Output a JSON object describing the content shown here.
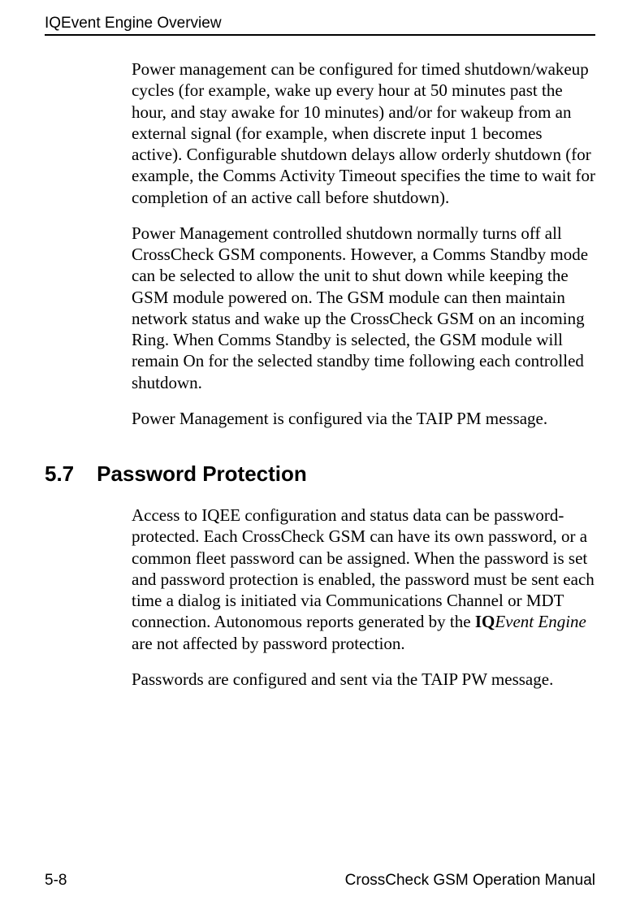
{
  "header": {
    "title": "IQEvent Engine Overview"
  },
  "content": {
    "para1": "Power management can be configured for timed shutdown/wakeup cycles (for example, wake up every hour at 50 minutes past the hour, and stay awake for 10 minutes) and/or for wakeup from an external signal (for example, when discrete input 1 becomes active). Configurable shutdown delays allow orderly shutdown (for example, the Comms Activity Timeout specifies the time to wait for completion of an active call before shutdown).",
    "para2": "Power Management controlled shutdown normally turns off all CrossCheck GSM components. However, a Comms Standby mode can be selected to allow the unit to shut down while keeping the GSM module powered on. The GSM module can then maintain network status and wake up the CrossCheck GSM on an incoming Ring. When Comms Standby is selected, the GSM module will remain On for the selected standby time following each controlled shutdown.",
    "para3": "Power Management is configured via the TAIP PM message."
  },
  "section": {
    "number": "5.7",
    "title": "Password Protection",
    "para1_part1": "Access to IQEE configuration and status data can be password-protected. Each CrossCheck GSM can have its own password, or a common fleet password can be assigned. When the password is set and password protection is enabled, the password must be sent each time a dialog is initiated via Communications Channel or MDT connection. Autonomous reports generated by the ",
    "para1_iq": "IQ",
    "para1_event": "Event Engine",
    "para1_part2": " are not affected by password protection.",
    "para2": "Passwords are configured and sent via the TAIP PW message."
  },
  "footer": {
    "page": "5-8",
    "manual": "CrossCheck GSM Operation Manual"
  }
}
